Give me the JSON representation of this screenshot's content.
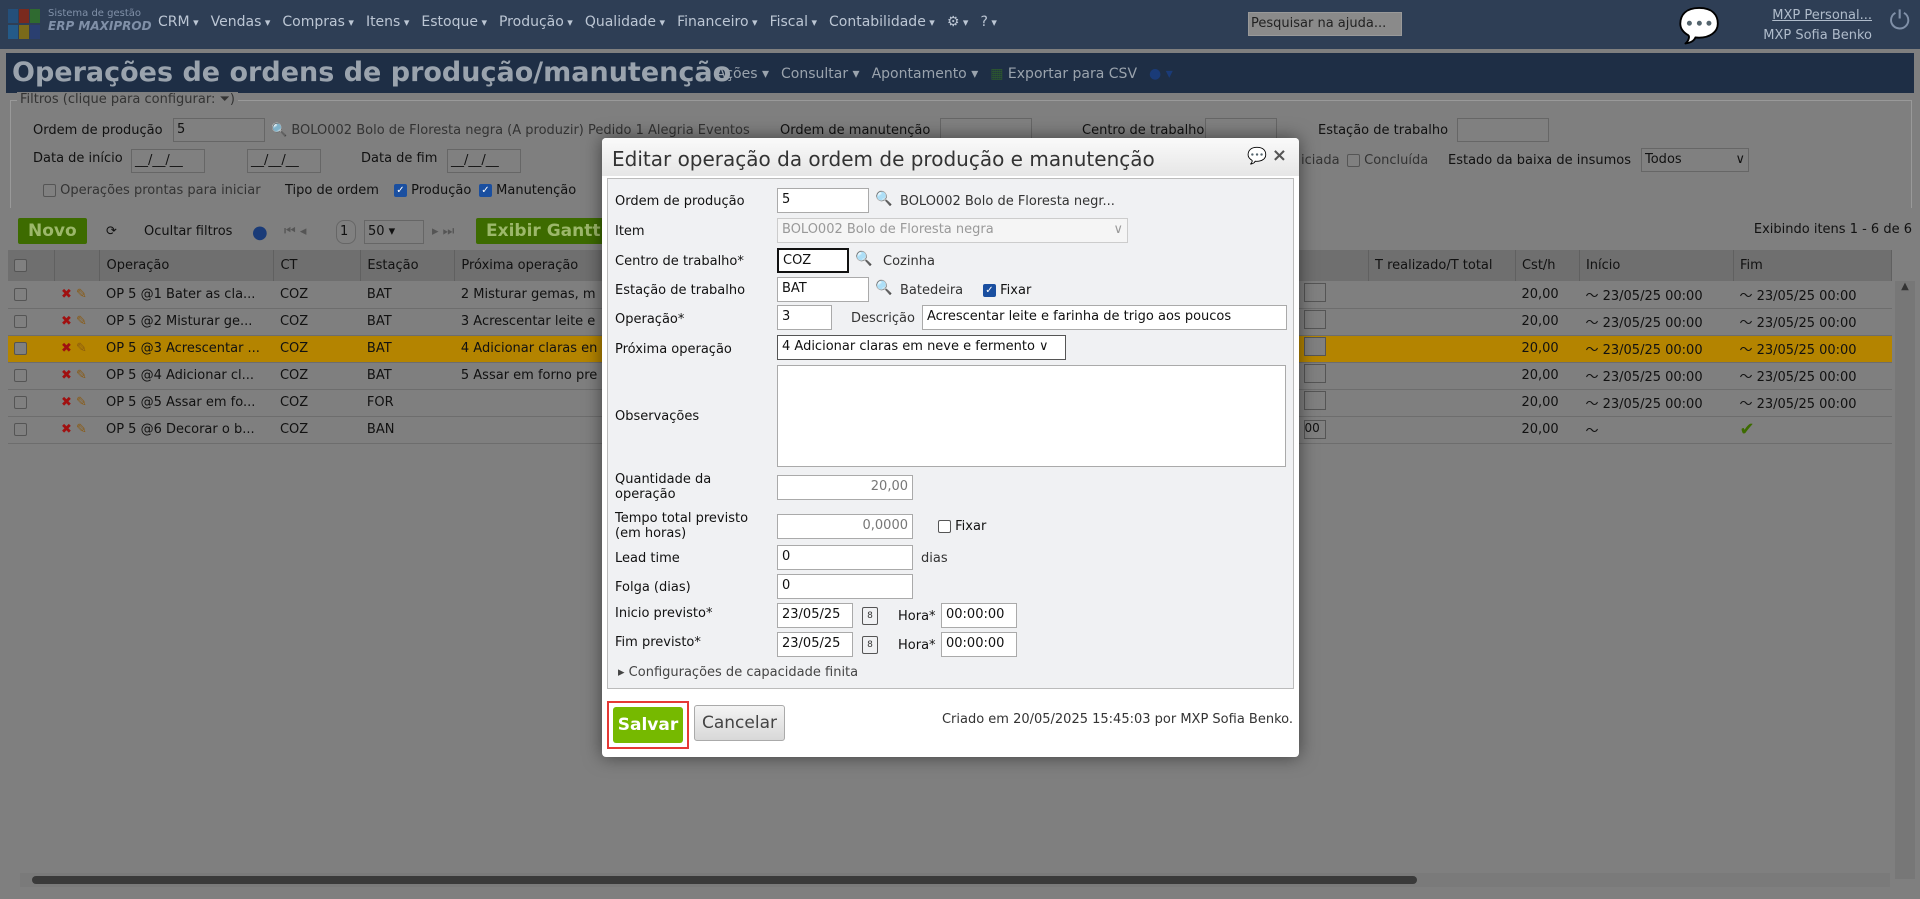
{
  "app": {
    "logo_line1": "Sistema de gestão",
    "logo_line2": "ERP MAXIPROD",
    "menu": [
      "CRM",
      "Vendas",
      "Compras",
      "Itens",
      "Estoque",
      "Produção",
      "Qualidade",
      "Financeiro",
      "Fiscal",
      "Contabilidade"
    ],
    "help_search_placeholder": "Pesquisar na ajuda...",
    "user_link": "MXP Personal...",
    "user_name": "MXP Sofia Benko"
  },
  "page": {
    "title": "Operações de ordens de produção/manutenção",
    "menu": [
      "Ações",
      "Consultar",
      "Apontamento"
    ],
    "export": "Exportar para CSV"
  },
  "filters": {
    "legend": "Filtros (clique para configurar:",
    "ordem_producao_label": "Ordem de produção",
    "ordem_producao_value": "5",
    "ordem_producao_desc": "BOLO002 Bolo de Floresta negra (A produzir) Pedido 1 Alegria Eventos",
    "ordem_manutencao_label": "Ordem de manutenção",
    "centro_label": "Centro de trabalho",
    "estacao_label": "Estação de trabalho",
    "data_inicio_label": "Data de início",
    "data_fim_label": "Data de fim",
    "date_placeholder": "__/__/__",
    "a": "a",
    "iniciada": "iciada",
    "concluida": "Concluída",
    "estado_baixa_label": "Estado da baixa de insumos",
    "estado_baixa_value": "Todos",
    "prontas": "Operações prontas para iniciar",
    "tipo_ordem": "Tipo de ordem",
    "producao": "Produção",
    "manutencao": "Manutenção"
  },
  "toolbar": {
    "novo": "Novo",
    "ocultar": "Ocultar filtros",
    "page": "1",
    "per_page": "50",
    "gantt": "Exibir Gantt",
    "exibindo": "Exibindo itens 1 - 6 de 6"
  },
  "table": {
    "headers": [
      "Operação",
      "CT",
      "Estação",
      "Próxima operação",
      "T realizado/T total",
      "Cst/h",
      "Início",
      "Fim"
    ],
    "rows": [
      {
        "op": "OP 5 @1 Bater as cla...",
        "ct": "COZ",
        "est": "BAT",
        "prox": "2 Misturar gemas, m",
        "cst": "20,00",
        "ini": "23/05/25 00:00",
        "fim": "23/05/25 00:00",
        "input": ""
      },
      {
        "op": "OP 5 @2 Misturar ge...",
        "ct": "COZ",
        "est": "BAT",
        "prox": "3 Acrescentar leite e",
        "cst": "20,00",
        "ini": "23/05/25 00:00",
        "fim": "23/05/25 00:00",
        "input": ""
      },
      {
        "op": "OP 5 @3 Acrescentar ...",
        "ct": "COZ",
        "est": "BAT",
        "prox": "4 Adicionar claras en",
        "cst": "20,00",
        "ini": "23/05/25 00:00",
        "fim": "23/05/25 00:00",
        "input": ""
      },
      {
        "op": "OP 5 @4 Adicionar cl...",
        "ct": "COZ",
        "est": "BAT",
        "prox": "5 Assar em forno pre",
        "cst": "20,00",
        "ini": "23/05/25 00:00",
        "fim": "23/05/25 00:00",
        "input": ""
      },
      {
        "op": "OP 5 @5 Assar em fo...",
        "ct": "COZ",
        "est": "FOR",
        "prox": "",
        "cst": "20,00",
        "ini": "23/05/25 00:00",
        "fim": "23/05/25 00:00",
        "input": ""
      },
      {
        "op": "OP 5 @6 Decorar o b...",
        "ct": "COZ",
        "est": "BAN",
        "prox": "",
        "cst": "20,00",
        "ini": "",
        "fim": "",
        "input": "00"
      }
    ],
    "highlight_row": 2
  },
  "dialog": {
    "title": "Editar operação da ordem de produção e manutenção",
    "ordem_label": "Ordem de produção",
    "ordem_value": "5",
    "ordem_desc": "BOLO002 Bolo de Floresta negr...",
    "item_label": "Item",
    "item_value": "BOLO002 Bolo de Floresta negra",
    "centro_label": "Centro de trabalho*",
    "centro_value": "COZ",
    "centro_desc": "Cozinha",
    "estacao_label": "Estação de trabalho",
    "estacao_value": "BAT",
    "estacao_desc": "Batedeira",
    "fixar": "Fixar",
    "operacao_label": "Operação*",
    "operacao_value": "3",
    "descricao_label": "Descrição",
    "descricao_value": "Acrescentar leite e farinha de trigo aos poucos",
    "proxima_label": "Próxima operação",
    "proxima_value": "4 Adicionar claras em neve e fermento",
    "obs_label": "Observações",
    "obs_value": "",
    "qtd_label": "Quantidade da operação",
    "qtd_value": "20,00",
    "tempo_label": "Tempo total previsto (em horas)",
    "tempo_value": "0,0000",
    "tempo_fixar": "Fixar",
    "lead_label": "Lead time",
    "lead_value": "0",
    "dias": "dias",
    "folga_label": "Folga (dias)",
    "folga_value": "0",
    "inicio_label": "Inicio previsto*",
    "inicio_date": "23/05/25",
    "inicio_hora": "00:00:00",
    "fim_label": "Fim previsto*",
    "fim_date": "23/05/25",
    "fim_hora": "00:00:00",
    "hora_label": "Hora*",
    "config": "Configurações de capacidade finita",
    "salvar": "Salvar",
    "cancelar": "Cancelar",
    "criado": "Criado em 20/05/2025 15:45:03 por MXP Sofia Benko."
  },
  "colors": {
    "accent_green": "#76b900",
    "highlight_row": "#b48400",
    "save_outline": "#e53935",
    "checkbox": "#1a4fa0"
  }
}
